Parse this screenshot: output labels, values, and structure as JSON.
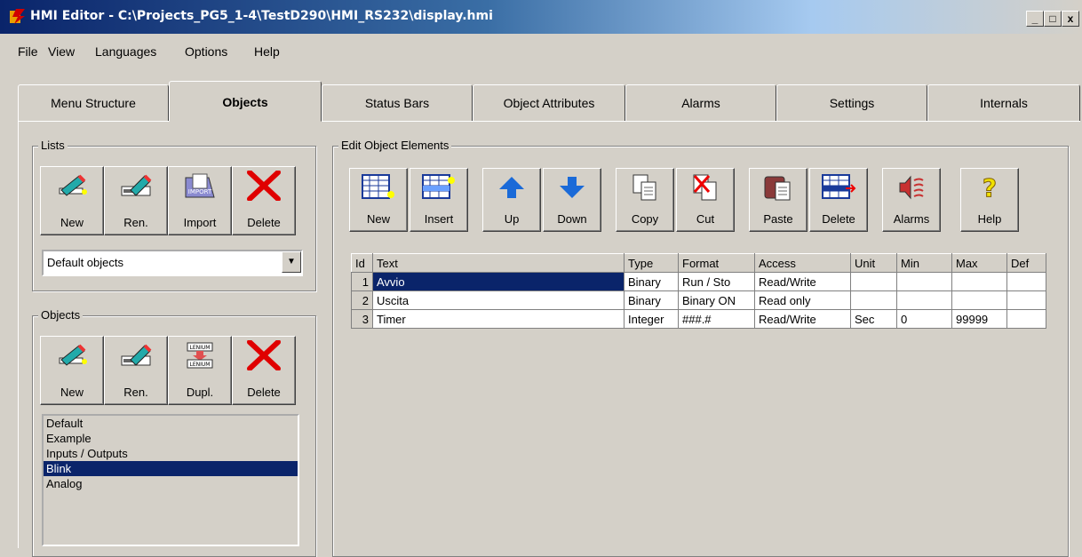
{
  "window": {
    "title": "HMI Editor - C:\\Projects_PG5_1-4\\TestD290\\HMI_RS232\\display.hmi",
    "controls": [
      "_",
      "□",
      "x"
    ]
  },
  "menu": [
    "File",
    "View",
    "Languages",
    "Options",
    "Help"
  ],
  "tabs": [
    "Menu Structure",
    "Objects",
    "Status Bars",
    "Object Attributes",
    "Alarms",
    "Settings",
    "Internals"
  ],
  "active_tab": "Objects",
  "lists": {
    "legend": "Lists",
    "buttons": {
      "new": "New",
      "rename": "Ren.",
      "import": "Import",
      "delete": "Delete"
    },
    "combo_value": "Default objects"
  },
  "objects": {
    "legend": "Objects",
    "buttons": {
      "new": "New",
      "rename": "Ren.",
      "duplicate": "Dupl.",
      "delete": "Delete"
    },
    "items": [
      "Default",
      "Example",
      "Inputs / Outputs",
      "Blink",
      "Analog"
    ],
    "selected": "Blink"
  },
  "edit": {
    "legend": "Edit Object Elements",
    "buttons": {
      "new": "New",
      "insert": "Insert",
      "up": "Up",
      "down": "Down",
      "copy": "Copy",
      "cut": "Cut",
      "paste": "Paste",
      "delete": "Delete",
      "alarms": "Alarms",
      "help": "Help"
    }
  },
  "icon_text": {
    "import": "IMPORT",
    "lenium": "LENIUM"
  },
  "grid": {
    "headers": [
      "Id",
      "Text",
      "Type",
      "Format",
      "Access",
      "Unit",
      "Min",
      "Max",
      "Def"
    ],
    "rows": [
      [
        "1",
        "Avvio",
        "Binary",
        "Run / Sto",
        "Read/Write",
        "",
        "",
        "",
        ""
      ],
      [
        "2",
        "Uscita",
        "Binary",
        "Binary ON",
        "Read only",
        "",
        "",
        "",
        ""
      ],
      [
        "3",
        "Timer",
        "Integer",
        "###.#",
        "Read/Write",
        "Sec",
        "0",
        "99999",
        ""
      ]
    ]
  }
}
